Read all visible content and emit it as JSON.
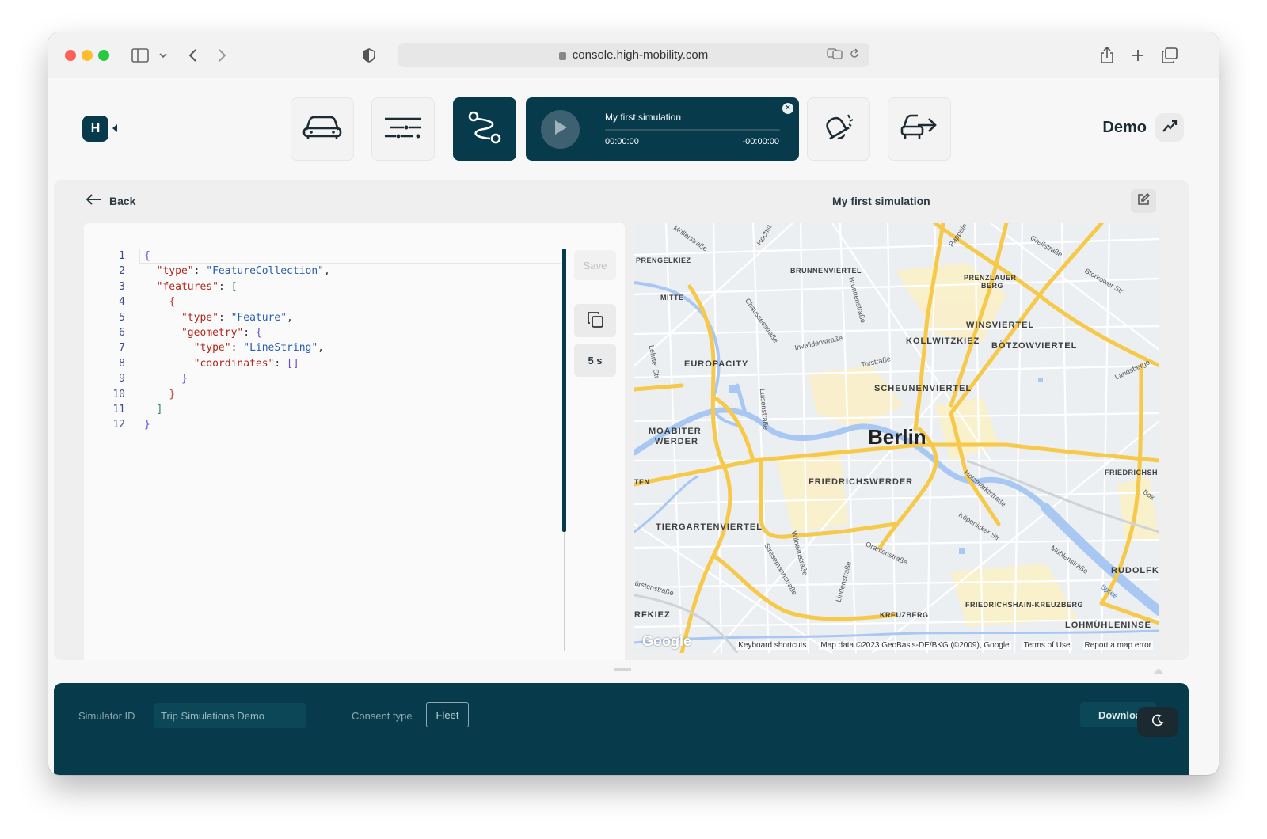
{
  "browser": {
    "url": "console.high-mobility.com"
  },
  "header": {
    "logo_text": "H",
    "nav": [
      {
        "name": "vehicles",
        "icon": "car-icon"
      },
      {
        "name": "data",
        "icon": "sliders-icon"
      },
      {
        "name": "trips",
        "icon": "route-icon",
        "active": true
      },
      {
        "name": "notifications",
        "icon": "bell-icon"
      },
      {
        "name": "export",
        "icon": "car-export-icon"
      }
    ],
    "player": {
      "title": "My first simulation",
      "time_elapsed": "00:00:00",
      "time_remaining": "-00:00:00",
      "progress": 0
    },
    "user_label": "Demo"
  },
  "content": {
    "back_label": "Back",
    "simulation_title": "My first simulation",
    "editor": {
      "lines": [
        {
          "n": "1",
          "indent": "",
          "tokens": [
            {
              "c": "b1",
              "t": "{"
            }
          ]
        },
        {
          "n": "2",
          "indent": "  ",
          "tokens": [
            {
              "c": "k",
              "t": "\"type\""
            },
            {
              "c": "p",
              "t": ": "
            },
            {
              "c": "s",
              "t": "\"FeatureCollection\""
            },
            {
              "c": "p",
              "t": ","
            }
          ]
        },
        {
          "n": "3",
          "indent": "  ",
          "tokens": [
            {
              "c": "k",
              "t": "\"features\""
            },
            {
              "c": "p",
              "t": ": "
            },
            {
              "c": "b2",
              "t": "["
            }
          ]
        },
        {
          "n": "4",
          "indent": "    ",
          "tokens": [
            {
              "c": "b3",
              "t": "{"
            }
          ]
        },
        {
          "n": "5",
          "indent": "      ",
          "tokens": [
            {
              "c": "k",
              "t": "\"type\""
            },
            {
              "c": "p",
              "t": ": "
            },
            {
              "c": "s",
              "t": "\"Feature\""
            },
            {
              "c": "p",
              "t": ","
            }
          ]
        },
        {
          "n": "6",
          "indent": "      ",
          "tokens": [
            {
              "c": "k",
              "t": "\"geometry\""
            },
            {
              "c": "p",
              "t": ": "
            },
            {
              "c": "b1",
              "t": "{"
            }
          ]
        },
        {
          "n": "7",
          "indent": "        ",
          "tokens": [
            {
              "c": "k",
              "t": "\"type\""
            },
            {
              "c": "p",
              "t": ": "
            },
            {
              "c": "s",
              "t": "\"LineString\""
            },
            {
              "c": "p",
              "t": ","
            }
          ]
        },
        {
          "n": "8",
          "indent": "        ",
          "tokens": [
            {
              "c": "k",
              "t": "\"coordinates\""
            },
            {
              "c": "p",
              "t": ": "
            },
            {
              "c": "b1",
              "t": "[]"
            }
          ]
        },
        {
          "n": "9",
          "indent": "      ",
          "tokens": [
            {
              "c": "b1",
              "t": "}"
            }
          ]
        },
        {
          "n": "10",
          "indent": "    ",
          "tokens": [
            {
              "c": "b3",
              "t": "}"
            }
          ]
        },
        {
          "n": "11",
          "indent": "  ",
          "tokens": [
            {
              "c": "b2",
              "t": "]"
            }
          ]
        },
        {
          "n": "12",
          "indent": "",
          "tokens": [
            {
              "c": "b1",
              "t": "}"
            }
          ]
        }
      ],
      "save_label": "Save",
      "interval_label": "5 s"
    },
    "map": {
      "labels": {
        "prenzlauer_kiez": "PRENGELKIEZ",
        "brunnenviertel": "BRUNNENVIERTEL",
        "prenzlauer_berg_1": "PRENZLAUER",
        "prenzlauer_berg_2": "BERG",
        "mitte": "MITTE",
        "winsviertel": "WINSVIERTEL",
        "kollwitzkiez": "KOLLWITZKIEZ",
        "boetzowviertel": "BÖTZOWVIERTEL",
        "europacity": "EUROPACITY",
        "scheunenviertel": "SCHEUNENVIERTEL",
        "moabiter_werder_1": "MOABITER",
        "moabiter_werder_2": "WERDER",
        "berlin": "Berlin",
        "ten": "TEN",
        "friedrichswerder": "FRIEDRICHSWERDER",
        "friedrichsh": "FRIEDRICHSH",
        "tiergartenviertel": "TIERGARTENVIERTEL",
        "rudolfk": "RUDOLFK",
        "friedrichshain_kreuzberg": "FRIEDRICHSHAIN-KREUZBERG",
        "rfkiez": "RFKIEZ",
        "kreuzberg": "KREUZBERG",
        "lohmuehleninsel": "LOHMÜHLENINSE"
      },
      "streets": {
        "muellerstrasse": "Müllerstraße",
        "hochst": "Hochst",
        "pappeln": "Pappeln",
        "greifstrasse": "Greifstraße",
        "storkower": "Storkower Str",
        "brunnenstrasse": "Brunnenstraße",
        "chausseestrasse": "Chausseestraße",
        "invalidenstrasse": "Invalidenstraße",
        "torstrasse": "Torstraße",
        "landsberger": "Landsberge",
        "luisenstrasse": "Luisenstraße",
        "holzmarktstrasse": "Holzmarktstraße",
        "box": "Box",
        "koepenicker": "Köpenicker Str",
        "oranienstrasse": "Oranienstraße",
        "wilhelmstrasse": "Wilhelmstraße",
        "stresemannstrasse": "Stresemannstraße",
        "lindenstrasse": "Lindenstraße",
        "muehlenstrasse": "Mühlenstraße",
        "spree": "Spree",
        "fuerstenstrasse": "ürstenstraße",
        "heidestrasse": "Lehrter Str"
      },
      "google": "Google",
      "attribution": {
        "shortcuts": "Keyboard shortcuts",
        "map_data": "Map data ©2023 GeoBasis-DE/BKG (©2009), Google",
        "terms": "Terms of Use",
        "report": "Report a map error"
      }
    }
  },
  "bottom_bar": {
    "simulator_id_label": "Simulator ID",
    "simulator_id_value": "Trip Simulations Demo",
    "consent_label": "Consent type",
    "consent_value": "Fleet",
    "download_label": "Download"
  },
  "colors": {
    "brand": "#073b4c",
    "road_major": "#f6c94b",
    "water": "#a8c7f2"
  }
}
